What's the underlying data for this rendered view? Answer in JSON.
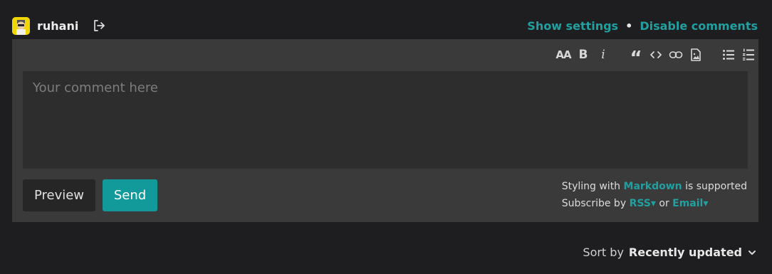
{
  "user": {
    "name": "ruhani"
  },
  "header": {
    "show_settings": "Show settings",
    "separator": "•",
    "disable_comments": "Disable comments"
  },
  "toolbar": {
    "icons": [
      "text-size-icon",
      "bold-icon",
      "italic-icon",
      "quote-icon",
      "code-icon",
      "link-icon",
      "image-icon",
      "bullet-list-icon",
      "numbered-list-icon"
    ],
    "labels": {
      "text_size": "AA",
      "bold": "B",
      "italic": "i",
      "quote": "“"
    }
  },
  "editor": {
    "placeholder": "Your comment here"
  },
  "buttons": {
    "preview": "Preview",
    "send": "Send"
  },
  "info": {
    "styling_prefix": "Styling with",
    "markdown": "Markdown",
    "styling_suffix": "is supported",
    "subscribe_prefix": "Subscribe by",
    "rss": "RSS▾",
    "or": "or",
    "email": "Email▾"
  },
  "sort": {
    "label": "Sort by",
    "value": "Recently updated"
  },
  "colors": {
    "accent": "#20a0a0",
    "send_bg": "#129a9a",
    "background": "#1e1e20",
    "panel": "#3a3a3a"
  }
}
